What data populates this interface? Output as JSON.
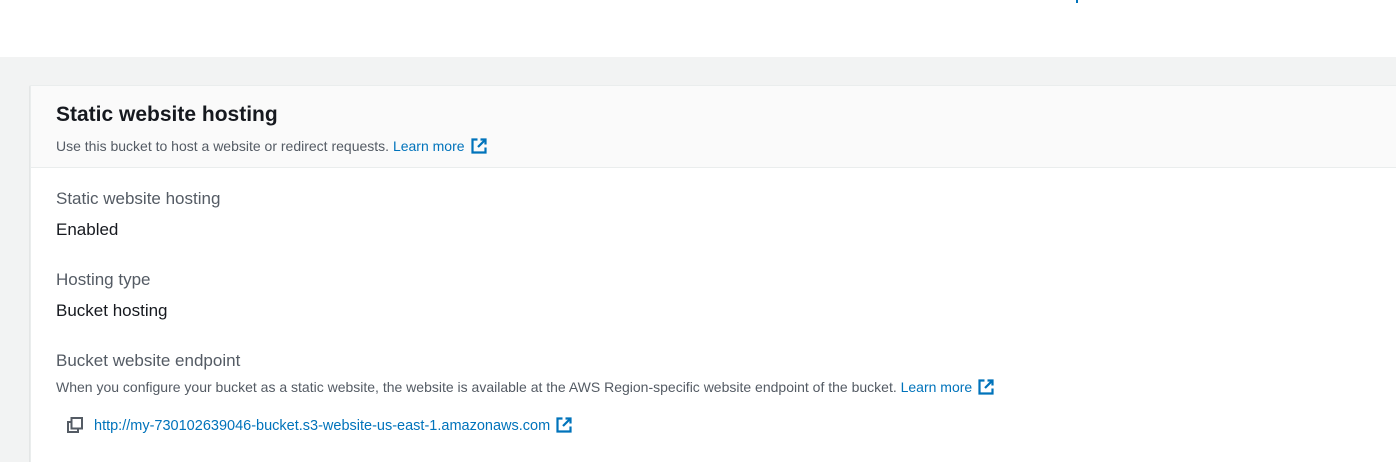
{
  "section": {
    "title": "Static website hosting",
    "description": "Use this bucket to host a website or redirect requests.",
    "learn_more": "Learn more"
  },
  "fields": {
    "hosting": {
      "label": "Static website hosting",
      "value": "Enabled"
    },
    "type": {
      "label": "Hosting type",
      "value": "Bucket hosting"
    },
    "endpoint": {
      "label": "Bucket website endpoint",
      "description": "When you configure your bucket as a static website, the website is available at the AWS Region-specific website endpoint of the bucket.",
      "learn_more": "Learn more",
      "url": "http://my-730102639046-bucket.s3-website-us-east-1.amazonaws.com"
    }
  },
  "icons": {
    "external": "external-link-icon",
    "copy": "copy-icon"
  },
  "colors": {
    "link": "#0073bb",
    "page_bg": "#f2f3f3",
    "text": "#16191f",
    "secondary_text": "#545b64"
  }
}
